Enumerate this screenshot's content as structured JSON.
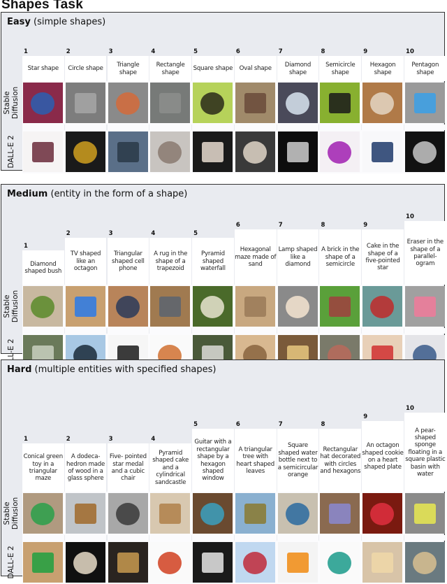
{
  "title": "Shapes Task",
  "row_labels": {
    "sd": "Stable Diffusion",
    "sd_line1": "Stable",
    "sd_line2": "Diffusion",
    "dalle": "DALL-E 2"
  },
  "sections": [
    {
      "name_bold": "Easy",
      "name_rest": " (simple shapes)",
      "items": [
        {
          "n": "1",
          "caption": "Star shape",
          "sd_img": "blue yellow star on red",
          "sd_bg": "#8a2a4a",
          "sd_fg": "#2a5fb0",
          "dalle_img": "scattered colored stars",
          "dalle_bg": "#f6f4f4",
          "dalle_fg": "#6a2a3a"
        },
        {
          "n": "2",
          "caption": "Circle shape",
          "sd_img": "gray ring",
          "sd_bg": "#7d7d7d",
          "sd_fg": "#a6a6a6",
          "dalle_img": "colorful rings",
          "dalle_bg": "#1a1a1a",
          "dalle_fg": "#d0a020"
        },
        {
          "n": "3",
          "caption": "Triangle shape",
          "sd_img": "orange triangle",
          "sd_bg": "#8a8a8a",
          "sd_fg": "#d46a3a",
          "dalle_img": "dark triangles",
          "dalle_bg": "#5a6f88",
          "dalle_fg": "#2a3a48"
        },
        {
          "n": "4",
          "caption": "Rectangle shape",
          "sd_img": "gray rectangle",
          "sd_bg": "#777a78",
          "sd_fg": "#8c8e8c",
          "dalle_img": "rectangular lattice",
          "dalle_bg": "#c8c4c0",
          "dalle_fg": "#8a7a70"
        },
        {
          "n": "5",
          "caption": "Square shape",
          "sd_img": "green squares pattern",
          "sd_bg": "#b6d25a",
          "sd_fg": "#2a2a1a",
          "dalle_img": "white bracket shape",
          "dalle_bg": "#1a1a1a",
          "dalle_fg": "#e8dcd0"
        },
        {
          "n": "6",
          "caption": "Oval shape",
          "sd_img": "brown oval ring",
          "sd_bg": "#a08a6a",
          "sd_fg": "#6a4a3a",
          "dalle_img": "checkered vase",
          "dalle_bg": "#3a3a3a",
          "dalle_fg": "#e0d6c8"
        },
        {
          "n": "7",
          "caption": "Diamond shape",
          "sd_img": "cut diamond",
          "sd_bg": "#4a4a5a",
          "sd_fg": "#d8e4f0",
          "dalle_img": "crystal diamond",
          "dalle_bg": "#0d0d0d",
          "dalle_fg": "#cfcfcf"
        },
        {
          "n": "8",
          "caption": "Semicircle shape",
          "sd_img": "black arc on green",
          "sd_bg": "#88b030",
          "sd_fg": "#1a1a1a",
          "dalle_img": "purple word art",
          "dalle_bg": "#f4f0f4",
          "dalle_fg": "#a020b0"
        },
        {
          "n": "9",
          "caption": "Hexagon shape",
          "sd_img": "hexagon tiles",
          "sd_bg": "#b07a48",
          "sd_fg": "#e4d6c4",
          "dalle_img": "blue hexagon",
          "dalle_bg": "#f8f8fa",
          "dalle_fg": "#1e3a6a"
        },
        {
          "n": "10",
          "caption": "Pentagon shape",
          "sd_img": "blue frame pentagon",
          "sd_bg": "#9a9a9a",
          "sd_fg": "#3aa0e8",
          "dalle_img": "glass pentagon",
          "dalle_bg": "#121212",
          "dalle_fg": "#c8c8c8"
        }
      ]
    },
    {
      "name_bold": "Medium",
      "name_rest": " (entity in the form of a shape)",
      "items": [
        {
          "n": "1",
          "caption": "Diamond shaped bush",
          "sd_img": "green bush",
          "sd_bg": "#c8b8a0",
          "sd_fg": "#5a8a2a",
          "dalle_img": "foliage",
          "dalle_bg": "#6a7a5a",
          "dalle_fg": "#c8d0c0"
        },
        {
          "n": "2",
          "caption": "TV shaped like an octagon",
          "sd_img": "octagon tv",
          "sd_bg": "#c8a070",
          "sd_fg": "#2a7ae8",
          "dalle_img": "flat tv",
          "dalle_bg": "#a8c8e4",
          "dalle_fg": "#1a2a3a"
        },
        {
          "n": "3",
          "caption": "Triangular shaped cell phone",
          "sd_img": "smartphone",
          "sd_bg": "#b8845a",
          "sd_fg": "#2a3a5a",
          "dalle_img": "white phone",
          "dalle_bg": "#f6f6f6",
          "dalle_fg": "#1a1a1a"
        },
        {
          "n": "4",
          "caption": "A rug in the shape of a trapezoid",
          "sd_img": "gray rug",
          "sd_bg": "#a07a50",
          "sd_fg": "#5a6470",
          "dalle_img": "orange rug",
          "dalle_bg": "#fafafa",
          "dalle_fg": "#d07030"
        },
        {
          "n": "5",
          "caption": "Pyramid shaped waterfall",
          "sd_img": "waterfall",
          "sd_bg": "#4a6a2a",
          "sd_fg": "#e8e4d0",
          "dalle_img": "cascade",
          "dalle_bg": "#4a5a3a",
          "dalle_fg": "#dcdcd8"
        },
        {
          "n": "6",
          "caption": "Hexagonal maze made of sand",
          "sd_img": "sand maze",
          "sd_bg": "#c8a880",
          "sd_fg": "#9a7a58",
          "dalle_img": "hexagonal sand rings",
          "dalle_bg": "#d8b890",
          "dalle_fg": "#8a6440"
        },
        {
          "n": "7",
          "caption": "Lamp shaped like a diamond",
          "sd_img": "crystal lamp",
          "sd_bg": "#8a8a8a",
          "sd_fg": "#f4e4d0",
          "dalle_img": "golden faceted lamp",
          "dalle_bg": "#7a5a3a",
          "dalle_fg": "#e8c880"
        },
        {
          "n": "8",
          "caption": "A brick in the shape of a semicircle",
          "sd_img": "red brick",
          "sd_bg": "#5aa03a",
          "sd_fg": "#a04040",
          "dalle_img": "brick",
          "dalle_bg": "#7a7a6a",
          "dalle_fg": "#b86a5a"
        },
        {
          "n": "9",
          "caption": "Cake in the shape of a five-pointed star",
          "sd_img": "red star cake",
          "sd_bg": "#6a9a98",
          "sd_fg": "#c02a2a",
          "dalle_img": "bundt cake",
          "dalle_bg": "#e8d0b8",
          "dalle_fg": "#d03030"
        },
        {
          "n": "10",
          "caption": "Eraser in the shape of a parallel- ogram",
          "sd_img": "pink eraser",
          "sd_bg": "#a0a0a0",
          "sd_fg": "#f07a9a",
          "dalle_img": "blue eraser",
          "dalle_bg": "#e4e4e8",
          "dalle_fg": "#3a5a8a"
        }
      ]
    },
    {
      "name_bold": "Hard",
      "name_rest": " (multiple entities with specified shapes)",
      "items": [
        {
          "n": "1",
          "caption": "Conical green toy in a triangular maze",
          "sd_img": "green triangles",
          "sd_bg": "#b09a80",
          "sd_fg": "#2aa04a",
          "dalle_img": "green ball",
          "dalle_bg": "#c8a070",
          "dalle_fg": "#20a040"
        },
        {
          "n": "2",
          "caption": "A dodeca- hedron made of wood in a glass sphere",
          "sd_img": "wooden dodecahedron",
          "sd_bg": "#c0c4c8",
          "sd_fg": "#a06a2a",
          "dalle_img": "sphere lattice",
          "dalle_bg": "#101010",
          "dalle_fg": "#e8dcc8"
        },
        {
          "n": "3",
          "caption": "Five- pointed star medal and a cubic chair",
          "sd_img": "star pendant",
          "sd_bg": "#a8a8a8",
          "sd_fg": "#3a3a3a",
          "dalle_img": "chair and star",
          "dalle_bg": "#2a2420",
          "dalle_fg": "#c89a50"
        },
        {
          "n": "4",
          "caption": "Pyramid shaped cake and a cylindrical sandcastle",
          "sd_img": "pyramid",
          "sd_bg": "#d8c8b0",
          "sd_fg": "#b0804a",
          "dalle_img": "red cake",
          "dalle_bg": "#fafafa",
          "dalle_fg": "#d04020"
        },
        {
          "n": "5",
          "caption": "Guitar with a rectangular shape by a hexagon shaped window",
          "sd_img": "guitar",
          "sd_bg": "#6a4a30",
          "sd_fg": "#3aa0c0",
          "dalle_img": "hexagon window",
          "dalle_bg": "#1a1a1a",
          "dalle_fg": "#e8e8e8"
        },
        {
          "n": "6",
          "caption": "A triangular tree with heart shaped leaves",
          "sd_img": "heart leaf",
          "sd_bg": "#8ab0d0",
          "sd_fg": "#8a7a30",
          "dalle_img": "heart tree",
          "dalle_bg": "#c0d8f0",
          "dalle_fg": "#c02a3a"
        },
        {
          "n": "7",
          "caption": "Square shaped water bottle next to a semicircular orange",
          "sd_img": "bottle and box",
          "sd_bg": "#c8c0b0",
          "sd_fg": "#2a6aa0",
          "dalle_img": "bottle and orange",
          "dalle_bg": "#f4f4f4",
          "dalle_fg": "#f08a10"
        },
        {
          "n": "8",
          "caption": "Rectangular hat decorated with circles and hexagons",
          "sd_img": "dotted hat",
          "sd_bg": "#8a6a50",
          "sd_fg": "#8a88d0",
          "dalle_img": "teal hat",
          "dalle_bg": "#fafafa",
          "dalle_fg": "#1a9a8a"
        },
        {
          "n": "9",
          "caption": "An octagon shaped cookie on a heart shaped plate",
          "sd_img": "heart cookie",
          "sd_bg": "#7a1a10",
          "sd_fg": "#e03040",
          "dalle_img": "heart cookie plate",
          "dalle_bg": "#d8c4a8",
          "dalle_fg": "#f0d8a8"
        },
        {
          "n": "10",
          "caption": "A pear- shaped sponge floating in a square plastic basin with water",
          "sd_img": "yellow sponge",
          "sd_bg": "#8a8a8a",
          "sd_fg": "#e8e850",
          "dalle_img": "sponge in basin",
          "dalle_bg": "#6a7a80",
          "dalle_fg": "#d8c090"
        }
      ]
    }
  ]
}
